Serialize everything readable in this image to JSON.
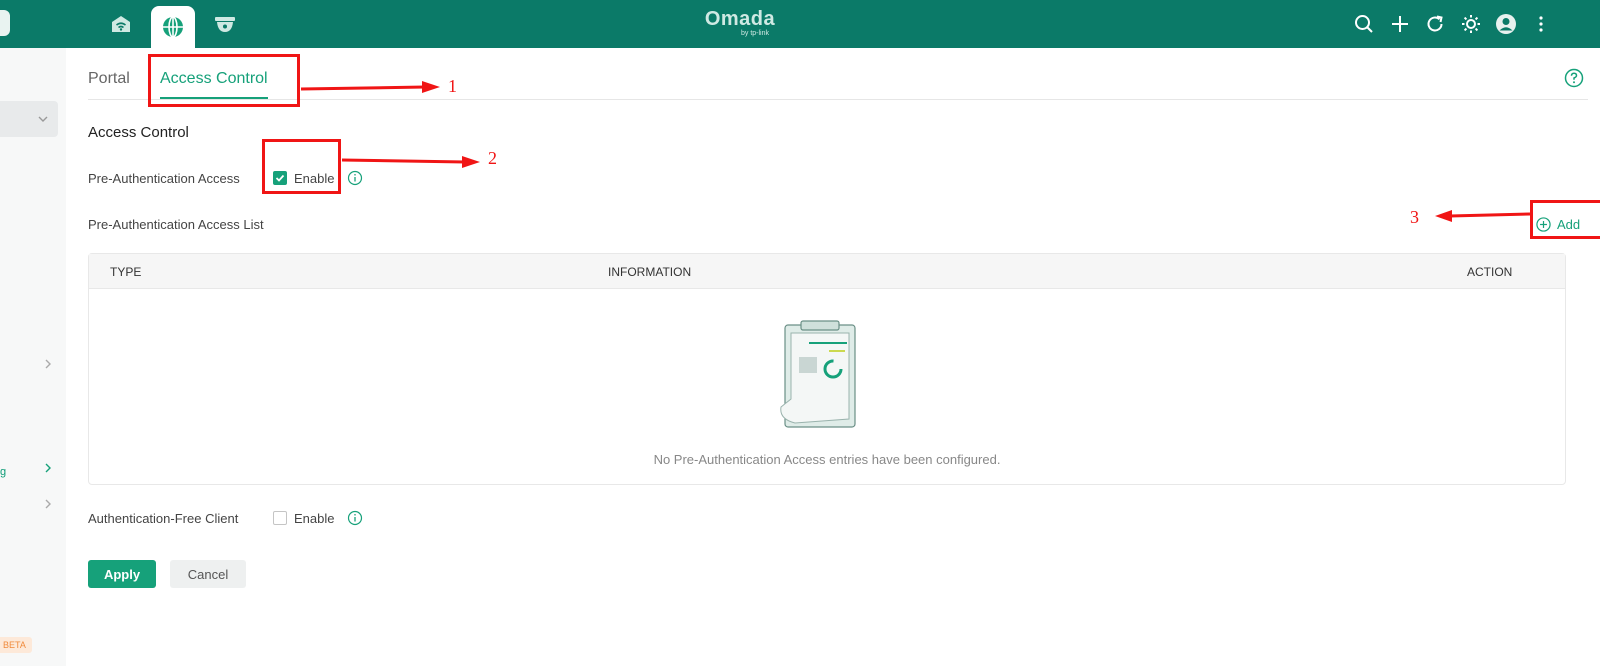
{
  "brand": {
    "name": "Omada",
    "sub": "by tp-link"
  },
  "top_nav": [
    {
      "icon": "router-icon",
      "active": false
    },
    {
      "icon": "globe-icon",
      "active": true
    },
    {
      "icon": "camera-icon",
      "active": false
    }
  ],
  "toolbar_icons": [
    "search-icon",
    "plus-icon",
    "refresh-icon",
    "theme-icon",
    "avatar-icon",
    "more-icon"
  ],
  "sidebar": {
    "beta_label": "BETA"
  },
  "tabs": [
    {
      "label": "Portal",
      "active": false
    },
    {
      "label": "Access Control",
      "active": true
    }
  ],
  "section": {
    "title": "Access Control",
    "pre_auth_access_label": "Pre-Authentication Access",
    "pre_auth_enable_label": "Enable",
    "pre_auth_enabled": true,
    "pre_auth_list_label": "Pre-Authentication Access List",
    "add_label": "Add",
    "auth_free_label": "Authentication-Free Client",
    "auth_free_enable_label": "Enable",
    "auth_free_enabled": false
  },
  "table": {
    "columns": [
      "TYPE",
      "INFORMATION",
      "ACTION"
    ],
    "rows": [],
    "empty_text": "No Pre-Authentication Access entries have been configured."
  },
  "buttons": {
    "apply": "Apply",
    "cancel": "Cancel"
  },
  "annotations": [
    "1",
    "2",
    "3"
  ],
  "colors": {
    "header": "#0b7a68",
    "accent": "#16a17a",
    "annotation": "#f01515"
  }
}
